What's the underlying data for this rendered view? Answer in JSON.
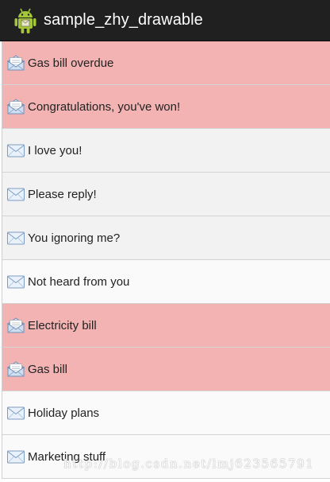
{
  "action_bar": {
    "title": "sample_zhy_drawable",
    "icon": "android-robot-icon",
    "bg_color": "#202020"
  },
  "messages": [
    {
      "label": "Gas bill overdue",
      "state": "read",
      "icon": "open-envelope-icon"
    },
    {
      "label": "Congratulations, you've won!",
      "state": "read",
      "icon": "open-envelope-icon"
    },
    {
      "label": "I love you!",
      "state": "unread",
      "icon": "closed-envelope-icon"
    },
    {
      "label": "Please reply!",
      "state": "unread",
      "icon": "closed-envelope-icon"
    },
    {
      "label": "You ignoring me?",
      "state": "unread",
      "icon": "closed-envelope-icon"
    },
    {
      "label": "Not heard from you",
      "state": "unread",
      "icon": "closed-envelope-icon"
    },
    {
      "label": "Electricity bill",
      "state": "read",
      "icon": "open-envelope-icon"
    },
    {
      "label": "Gas bill",
      "state": "read",
      "icon": "open-envelope-icon"
    },
    {
      "label": "Holiday plans",
      "state": "unread",
      "icon": "closed-envelope-icon"
    },
    {
      "label": "Marketing stuff",
      "state": "unread",
      "icon": "closed-envelope-icon"
    }
  ],
  "colors": {
    "read_row": "#f4b3b3",
    "unread_row": "#f2f2f2"
  },
  "watermark": {
    "text": "http://blog.csdn.net/lmj623565791"
  }
}
